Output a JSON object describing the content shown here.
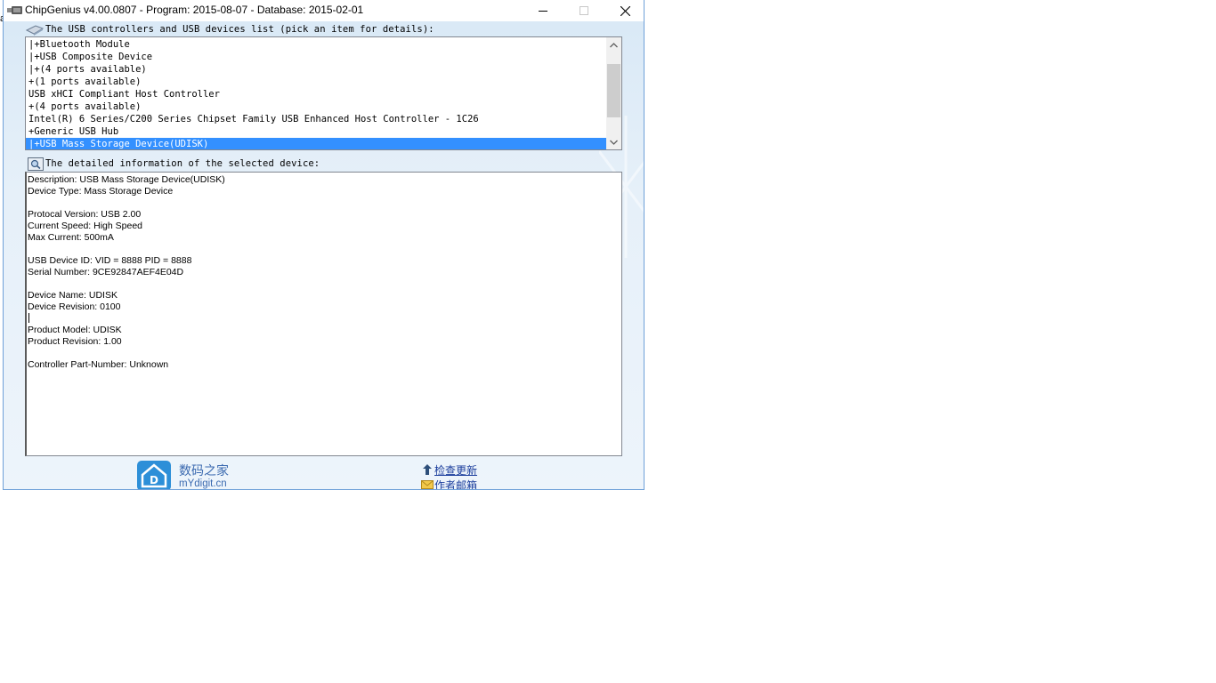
{
  "window": {
    "title": "ChipGenius v4.00.0807 - Program: 2015-08-07 - Database: 2015-02-01",
    "controls": {
      "minimize": "—",
      "maximize": "☐",
      "close": "✕"
    }
  },
  "device_list": {
    "label": "The USB controllers and USB devices list (pick an item for details):",
    "items": [
      "|+Bluetooth Module",
      "|+USB Composite Device",
      "|+(4 ports available)",
      "+(1 ports available)",
      "USB xHCI Compliant Host Controller",
      "+(4 ports available)",
      "Intel(R) 6 Series/C200 Series Chipset Family USB Enhanced Host Controller - 1C26",
      "+Generic USB Hub",
      "|+USB Mass Storage Device(UDISK)"
    ],
    "selected_index": 8
  },
  "detail": {
    "label": "The detailed information of the selected device:",
    "lines": [
      "Description: USB Mass Storage Device(UDISK)",
      "Device Type: Mass Storage Device",
      "",
      "Protocal Version: USB 2.00",
      "Current Speed: High Speed",
      "Max Current: 500mA",
      "",
      "USB Device ID: VID = 8888 PID = 8888",
      "Serial Number: 9CE92847AEF4E04D",
      "",
      "Device Name: UDISK",
      "Device Revision: 0100",
      "",
      "Product Model: UDISK",
      "Product Revision: 1.00",
      "",
      "Controller Part-Number: Unknown"
    ]
  },
  "footer": {
    "site_name_cn": "数码之家",
    "site_url": "mYdigit.cn",
    "check_update": "检查更新",
    "author_email": "作者邮箱"
  },
  "colors": {
    "selection": "#3390ff",
    "link": "#1a3d9c",
    "brand": "#3b6ab0"
  }
}
